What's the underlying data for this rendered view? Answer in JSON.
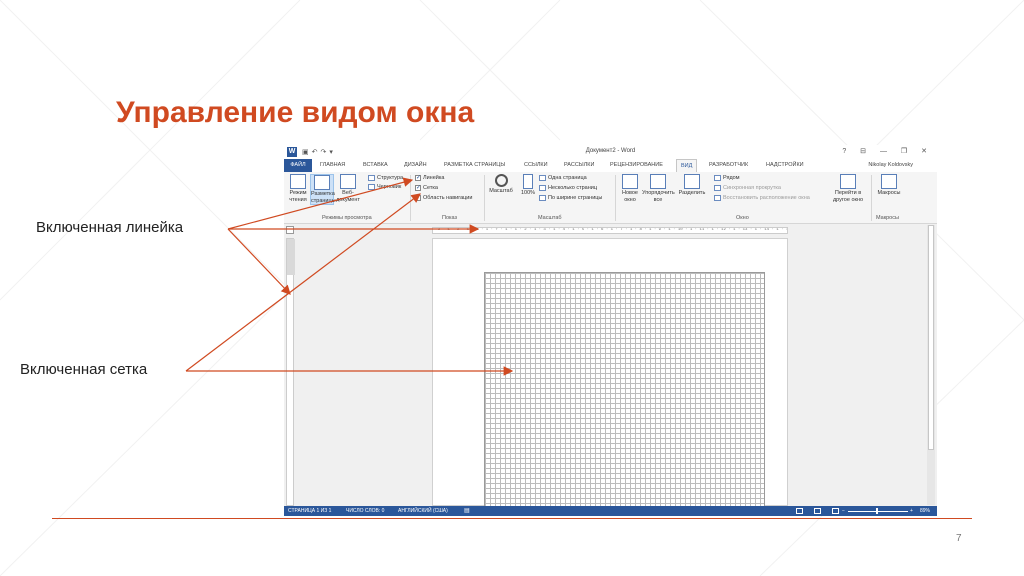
{
  "slide": {
    "title": "Управление видом окна",
    "number": "7",
    "callout_ruler": "Включенная линейка",
    "callout_grid": "Включенная сетка",
    "accent_color": "#d04a21"
  },
  "word": {
    "title": "Документ2 - Word",
    "app_icon": "W",
    "controls": "? ⊟ — ❐ ✕",
    "user": "Nikolay Koldovsky",
    "tabs": [
      "ФАЙЛ",
      "ГЛАВНАЯ",
      "ВСТАВКА",
      "ДИЗАЙН",
      "РАЗМЕТКА СТРАНИЦЫ",
      "ССЫЛКИ",
      "РАССЫЛКИ",
      "РЕЦЕНЗИРОВАНИЕ",
      "ВИД",
      "РАЗРАБОТЧИК",
      "НАДСТРОЙКИ"
    ],
    "active_tab": "ВИД",
    "ribbon": {
      "views": {
        "read": "Режим чтения",
        "layout": "Разметка страницы",
        "web": "Веб-документ",
        "structure": "Структура",
        "draft": "Черновик",
        "label": "Режимы просмотра"
      },
      "show": {
        "ruler": "Линейка",
        "grid": "Сетка",
        "nav": "Область навигации",
        "ruler_checked": true,
        "grid_checked": true,
        "nav_checked": false,
        "label": "Показ"
      },
      "zoom": {
        "zoom_btn": "Масштаб",
        "pct_btn": "100%",
        "one_page": "Одна страница",
        "multi_page": "Несколько страниц",
        "page_width": "По ширине страницы",
        "label": "Масштаб"
      },
      "window": {
        "new": "Новое окно",
        "arrange": "Упорядочить все",
        "split": "Разделить",
        "side": "Рядом",
        "sync": "Синхронная прокрутка",
        "reset": "Восстановить расположение окна",
        "switch": "Перейти в другое окно",
        "label": "Окно"
      },
      "macros": {
        "btn": "Макросы",
        "label": "Макросы"
      }
    },
    "ruler_text": "· 3 · 1 · 2 · 1 · 1 · 1 · ▿ · 1 · 1 · 2 · 1 · 3 · 1 · 4 · 1 · 5 · 1 · 6 · 1 · 7 · 1 · 8 · 1 · 9 · 1 · 10 · 1 · 11 · 1 · 12 · 1 · 13 · 1 · 14 · 1 · 15 · 1 · 16 · 1 · 17",
    "status": {
      "page": "СТРАНИЦА 1 ИЗ 1",
      "words": "ЧИСЛО СЛОВ: 0",
      "lang": "АНГЛИЙСКИЙ (США)",
      "zoom": "89%"
    }
  }
}
